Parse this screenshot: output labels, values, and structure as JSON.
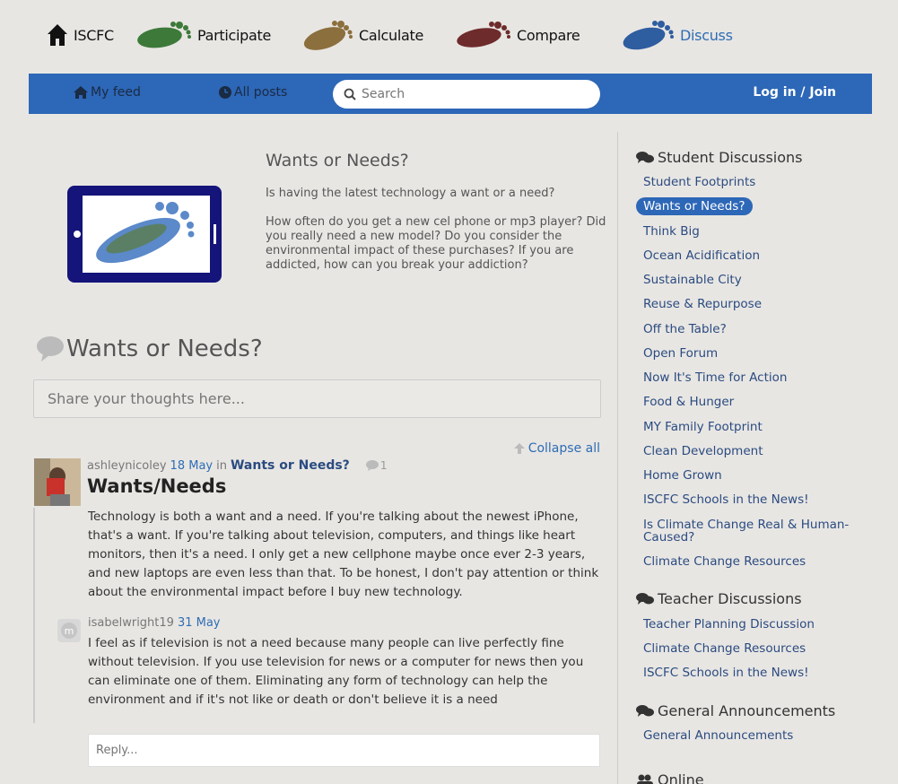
{
  "topnav": {
    "items": [
      {
        "label": "ISCFC",
        "icon": "house-icon"
      },
      {
        "label": "Participate",
        "icon": "green-footprint-icon",
        "color": "#3d7a3a"
      },
      {
        "label": "Calculate",
        "icon": "tan-footprint-icon",
        "color": "#8b6f3d"
      },
      {
        "label": "Compare",
        "icon": "red-footprint-icon",
        "color": "#6e2b2b"
      },
      {
        "label": "Discuss",
        "icon": "blue-footprint-icon",
        "color": "#2e5da0"
      }
    ]
  },
  "bluebar": {
    "my_feed": "My feed",
    "all_posts": "All posts",
    "search_placeholder": "Search",
    "login": "Log in / Join",
    "color": "#2d67b7"
  },
  "intro": {
    "title": "Wants or Needs?",
    "paragraphs": [
      "Is having the latest technology a want or a need?",
      "How often do you get a new cel phone or mp3 player? Did you really need a new model? Do you consider the environmental impact of these purchases? If you are addicted, how can you break your addiction?"
    ]
  },
  "discussion": {
    "title": "Wants or Needs?",
    "share_placeholder": "Share your thoughts here...",
    "collapse_all": "Collapse all"
  },
  "post": {
    "author": "ashleynicoley",
    "date": "18 May",
    "in": "in",
    "category": "Wants or Needs?",
    "comment_count": "1",
    "title": "Wants/Needs",
    "body": "Technology is both a want and a need. If you're talking about the newest iPhone, that's a want. If you're talking about television, computers, and things like heart monitors, then it's a need. I only get a new cellphone maybe once ever 2-3 years, and new laptops are even less than that. To be honest, I don't pay attention or think about the environmental impact before I buy new technology."
  },
  "reply": {
    "avatar_letter": "m",
    "author": "isabelwright19",
    "date": "31 May",
    "body": "I feel as if television is not a need because many people can live perfectly fine without television. If you use television for news or a computer for news then you can eliminate one of them. Eliminating any form of technology can help the environment and if it's not like or death or don't believe it is a need"
  },
  "reply_box": {
    "placeholder": "Reply..."
  },
  "sidebar": {
    "student_heading": "Student Discussions",
    "student_links": [
      "Student Footprints",
      "Wants or Needs?",
      "Think Big",
      "Ocean Acidification",
      "Sustainable City",
      "Reuse & Repurpose",
      "Off the Table?",
      "Open Forum",
      "Now It's Time for Action",
      "Food & Hunger",
      "MY Family Footprint",
      "Clean Development",
      "Home Grown",
      "ISCFC Schools in the News!",
      "Is Climate Change Real & Human-Caused?",
      "Climate Change Resources"
    ],
    "teacher_heading": "Teacher Discussions",
    "teacher_links": [
      "Teacher Planning Discussion",
      "Climate Change Resources",
      "ISCFC Schools in the News!"
    ],
    "general_heading": "General Announcements",
    "general_links": [
      "General Announcements"
    ],
    "online_heading": "Online"
  }
}
